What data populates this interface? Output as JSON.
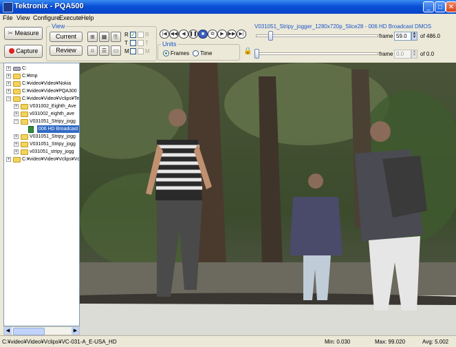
{
  "window": {
    "title": "Tektronix - PQA500",
    "minimize": "_",
    "maximize": "□",
    "close": "✕"
  },
  "menu": [
    "File",
    "View",
    "Configure",
    "Execute",
    "Help"
  ],
  "toolbar": {
    "measure_label": "Measure",
    "capture_label": "Capture",
    "view_group_label": "View",
    "current_label": "Current",
    "review_label": "Review",
    "rtm": {
      "r_label": "R",
      "t_label": "T",
      "m_label": "M",
      "r2_label": "R",
      "t2_label": "T",
      "m2_label": "M"
    },
    "units_label": "Units",
    "frames_label": "Frames",
    "time_label": "Time",
    "clip_title": "V031051_Stripy_jogger_1280x720p_Slice28 - 006 HD Broadcast DMOS",
    "frame_label": "frame",
    "frame_value": "59.0",
    "frame_total": "of 486.0",
    "frame2_label": "frame",
    "frame2_value": "0.0",
    "frame2_total": "of 0.0",
    "frame_position": 0.121
  },
  "tree": {
    "nodes": [
      {
        "depth": 0,
        "exp": "+",
        "icon": "drive",
        "label": "C:"
      },
      {
        "depth": 0,
        "exp": "+",
        "icon": "folder",
        "label": "C:¥tmp"
      },
      {
        "depth": 0,
        "exp": "+",
        "icon": "folder",
        "label": "C:¥video¥Video¥Nokia"
      },
      {
        "depth": 0,
        "exp": "+",
        "icon": "folder",
        "label": "C:¥video¥Video¥PQA300"
      },
      {
        "depth": 0,
        "exp": "−",
        "icon": "folder",
        "label": "C:¥video¥Video¥Vclips¥Te"
      },
      {
        "depth": 1,
        "exp": "+",
        "icon": "folder",
        "label": "V031002_Eighth_Ave"
      },
      {
        "depth": 1,
        "exp": "+",
        "icon": "folder",
        "label": "v031002_eighth_ave"
      },
      {
        "depth": 1,
        "exp": "−",
        "icon": "folder",
        "label": "V031051_Stripy_jogg"
      },
      {
        "depth": 2,
        "exp": "",
        "icon": "film",
        "label": "006 HD Broadcast",
        "selected": true
      },
      {
        "depth": 1,
        "exp": "+",
        "icon": "folder",
        "label": "V031051_Stripy_jogg"
      },
      {
        "depth": 1,
        "exp": "+",
        "icon": "folder",
        "label": "V031051_Stripy_jogg"
      },
      {
        "depth": 1,
        "exp": "+",
        "icon": "folder",
        "label": "v031051_stripy_jogg"
      },
      {
        "depth": 0,
        "exp": "+",
        "icon": "folder",
        "label": "C:¥video¥Video¥Vclips¥Vc"
      }
    ]
  },
  "status": {
    "path": "C:¥video¥Video¥Vclips¥VC-031-A_E-USA_HD",
    "min": "Min: 0.030",
    "max": "Max: 99.020",
    "avg": "Avg: 5.002"
  },
  "colors": {
    "accent": "#0a50d8",
    "selection": "#316ac5",
    "capture_dot": "#e02020"
  }
}
